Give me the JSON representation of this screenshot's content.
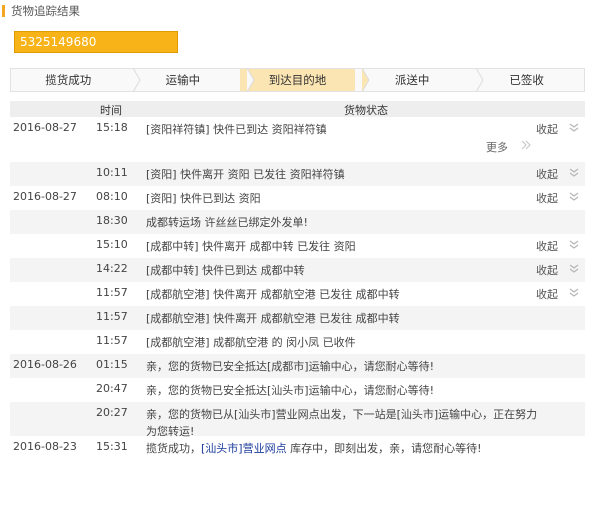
{
  "header": {
    "title": "货物追踪结果"
  },
  "tracking_number": "5325149680",
  "steps": [
    {
      "label": "揽货成功",
      "active": false
    },
    {
      "label": "运输中",
      "active": false
    },
    {
      "label": "到达目的地",
      "active": true
    },
    {
      "label": "派送中",
      "active": false
    },
    {
      "label": "已签收",
      "active": false
    }
  ],
  "table": {
    "col_time": "时间",
    "col_status": "货物状态",
    "fold_label": "收起",
    "more_label": "更多",
    "rows": [
      {
        "date": "2016-08-27",
        "time": "15:18",
        "desc": "[资阳祥符镇] 快件已到达 资阳祥符镇",
        "fold": true,
        "more": true
      },
      {
        "date": "",
        "time": "10:11",
        "desc": "[资阳] 快件离开 资阳 已发往 资阳祥符镇",
        "fold": true
      },
      {
        "date": "2016-08-27",
        "time": "08:10",
        "desc": "[资阳] 快件已到达 资阳",
        "fold": true
      },
      {
        "date": "",
        "time": "18:30",
        "desc": "成都转运场 许丝丝已绑定外发单!",
        "fold": false
      },
      {
        "date": "",
        "time": "15:10",
        "desc": "[成都中转] 快件离开 成都中转 已发往 资阳",
        "fold": true
      },
      {
        "date": "",
        "time": "14:22",
        "desc": "[成都中转] 快件已到达 成都中转",
        "fold": true
      },
      {
        "date": "",
        "time": "11:57",
        "desc": "[成都航空港] 快件离开 成都航空港 已发往 成都中转",
        "fold": true
      },
      {
        "date": "",
        "time": "11:57",
        "desc": "[成都航空港] 快件离开 成都航空港 已发往 成都中转",
        "fold": false
      },
      {
        "date": "",
        "time": "11:57",
        "desc": "[成都航空港] 成都航空港 的 闵小凤 已收件",
        "fold": false
      },
      {
        "date": "2016-08-26",
        "time": "01:15",
        "desc": "亲，您的货物已安全抵达[成都市]运输中心，请您耐心等待!",
        "fold": false
      },
      {
        "date": "",
        "time": "20:47",
        "desc": "亲，您的货物已安全抵达[汕头市]运输中心，请您耐心等待!",
        "fold": false
      },
      {
        "date": "",
        "time": "20:27",
        "desc": "亲，您的货物已从[汕头市]营业网点出发，下一站是[汕头市]运输中心，正在努力为您转运!",
        "fold": false
      },
      {
        "date": "2016-08-23",
        "time": "15:31",
        "desc_pre": "揽货成功，",
        "desc_link": "[汕头市]营业网点",
        "desc_post": " 库存中，即刻出发，亲，请您耐心等待!",
        "fold": false
      }
    ]
  }
}
